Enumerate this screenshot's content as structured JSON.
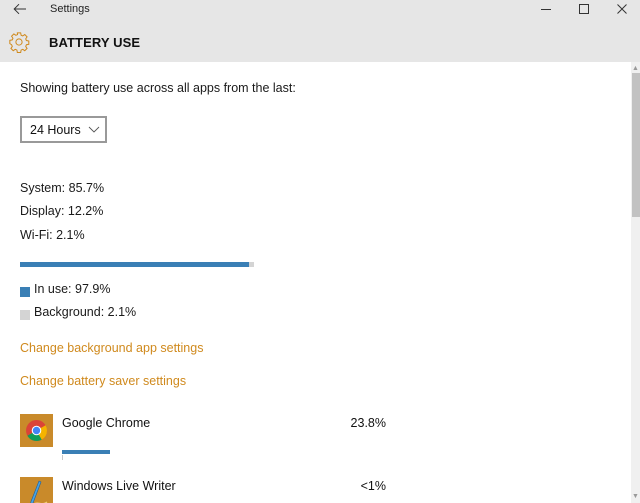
{
  "window": {
    "app_title": "Settings",
    "back_icon": "arrow-left-icon",
    "controls": {
      "minimize": "minimize-icon",
      "maximize": "maximize-icon",
      "close": "close-icon"
    }
  },
  "header": {
    "icon": "gear-icon",
    "title": "BATTERY USE"
  },
  "accent_color": "#d08a1e",
  "main": {
    "intro": "Showing battery use across all apps from the last:",
    "period_dropdown": {
      "selected": "24 Hours"
    },
    "breakdown": {
      "system": "System: 85.7%",
      "display": "Display: 12.2%",
      "wifi": "Wi-Fi: 2.1%"
    },
    "usage_bar": {
      "in_use_percent": 97.9,
      "background_percent": 2.1
    },
    "legend": {
      "in_use": "In use: 97.9%",
      "background": "Background: 2.1%"
    },
    "links": {
      "background_apps": "Change background app settings",
      "battery_saver": "Change battery saver settings"
    },
    "apps": [
      {
        "name": "Google Chrome",
        "percent_label": "23.8%",
        "percent": 23.8,
        "icon": "chrome-icon"
      },
      {
        "name": "Windows Live Writer",
        "percent_label": "<1%",
        "percent": 0.5,
        "icon": "windows-live-writer-icon"
      }
    ]
  }
}
